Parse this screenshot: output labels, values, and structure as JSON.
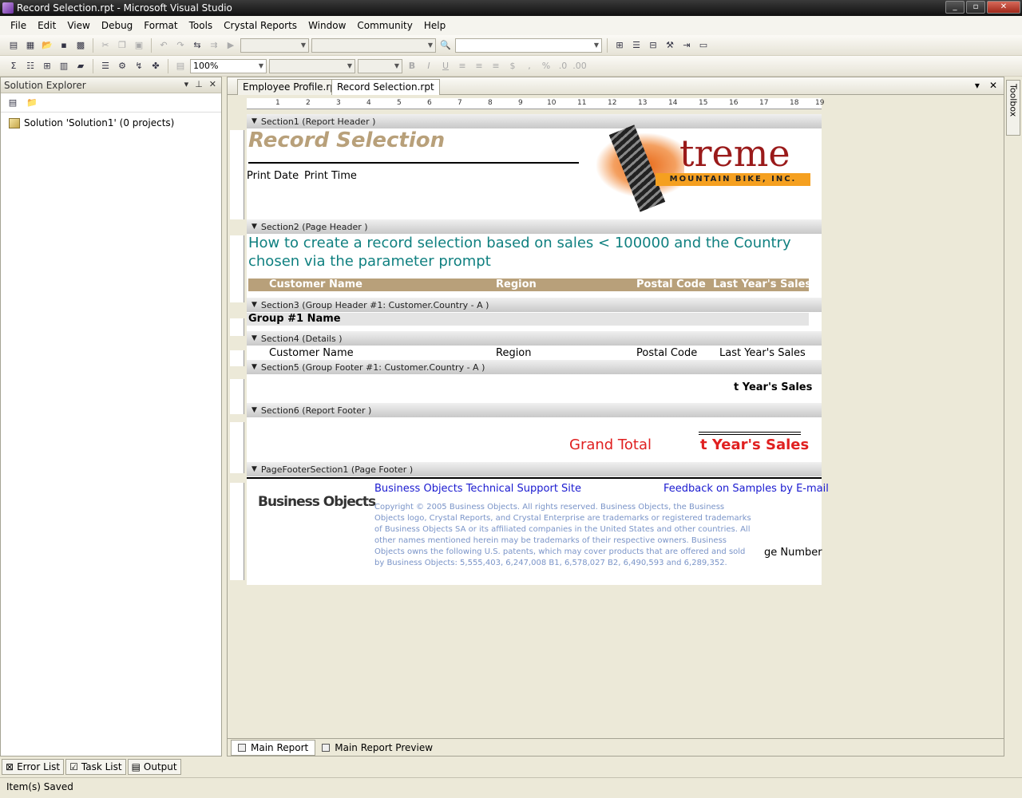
{
  "window": {
    "title": "Record Selection.rpt - Microsoft Visual Studio",
    "buttons": [
      "_",
      "▫",
      "✕"
    ]
  },
  "menu": [
    "File",
    "Edit",
    "View",
    "Debug",
    "Format",
    "Tools",
    "Crystal Reports",
    "Window",
    "Community",
    "Help"
  ],
  "toolbar2": {
    "zoom": "100%"
  },
  "solution_explorer": {
    "title": "Solution Explorer",
    "node": "Solution 'Solution1' (0 projects)"
  },
  "tabs": [
    {
      "label": "Employee Profile.rpt"
    },
    {
      "label": "Record Selection.rpt"
    }
  ],
  "ruler": [
    "1",
    "2",
    "3",
    "4",
    "5",
    "6",
    "7",
    "8",
    "9",
    "10",
    "11",
    "12",
    "13",
    "14",
    "15",
    "16",
    "17",
    "18",
    "19"
  ],
  "report": {
    "sections": {
      "s1": "Section1 (Report Header  )",
      "s2": "Section2 (Page Header  )",
      "s3": "Section3 (Group Header #1: Customer.Country - A )",
      "s4": "Section4 (Details  )",
      "s5": "Section5 (Group Footer #1: Customer.Country - A )",
      "s6": "Section6 (Report Footer  )",
      "pf": "PageFooterSection1 (Page Footer  )"
    },
    "title": "Record Selection",
    "print_date": "Print Date",
    "print_time": "Print Time",
    "logo_main": "treme",
    "logo_sub": "MOUNTAIN BIKE, INC.",
    "description": "How to create a record selection based on sales < 100000 and the Country chosen via the parameter prompt",
    "col_headers": [
      "Customer Name",
      "Region",
      "Postal Code",
      "Last Year's Sales"
    ],
    "group_name": "Group #1 Name",
    "details": [
      "Customer Name",
      "Region",
      "Postal Code",
      "Last Year's Sales"
    ],
    "group_footer_sum": "t Year's Sales",
    "grand_total": "Grand Total",
    "grand_total_value": "t Year's Sales",
    "bo_logo": "Business Objects",
    "support_link": "Business Objects Technical Support Site",
    "feedback_link": "Feedback on Samples by E-mail",
    "copyright": "Copyright © 2005 Business Objects. All rights reserved. Business Objects, the Business Objects logo, Crystal Reports, and Crystal Enterprise are trademarks or registered trademarks of Business Objects SA or its affiliated companies in the United States and other countries.  All other names mentioned herein may be trademarks of their respective owners. Business Objects owns the following U.S. patents, which may cover products that are offered and sold by Business Objects: 5,555,403, 6,247,008 B1, 6,578,027 B2, 6,490,593 and 6,289,352.",
    "page_number": "ge Number"
  },
  "view_tabs": [
    "Main Report",
    "Main Report Preview"
  ],
  "toolbox_label": "Toolbox",
  "bottom_tabs": [
    "Error List",
    "Task List",
    "Output"
  ],
  "status": "Item(s) Saved",
  "colors": {
    "title_gold": "#b8a07a",
    "teal": "#108080",
    "header_tan": "#b8a07a",
    "red": "#e02020",
    "link_blue": "#1a1ad0",
    "copyright_blue": "#7a94c8"
  }
}
